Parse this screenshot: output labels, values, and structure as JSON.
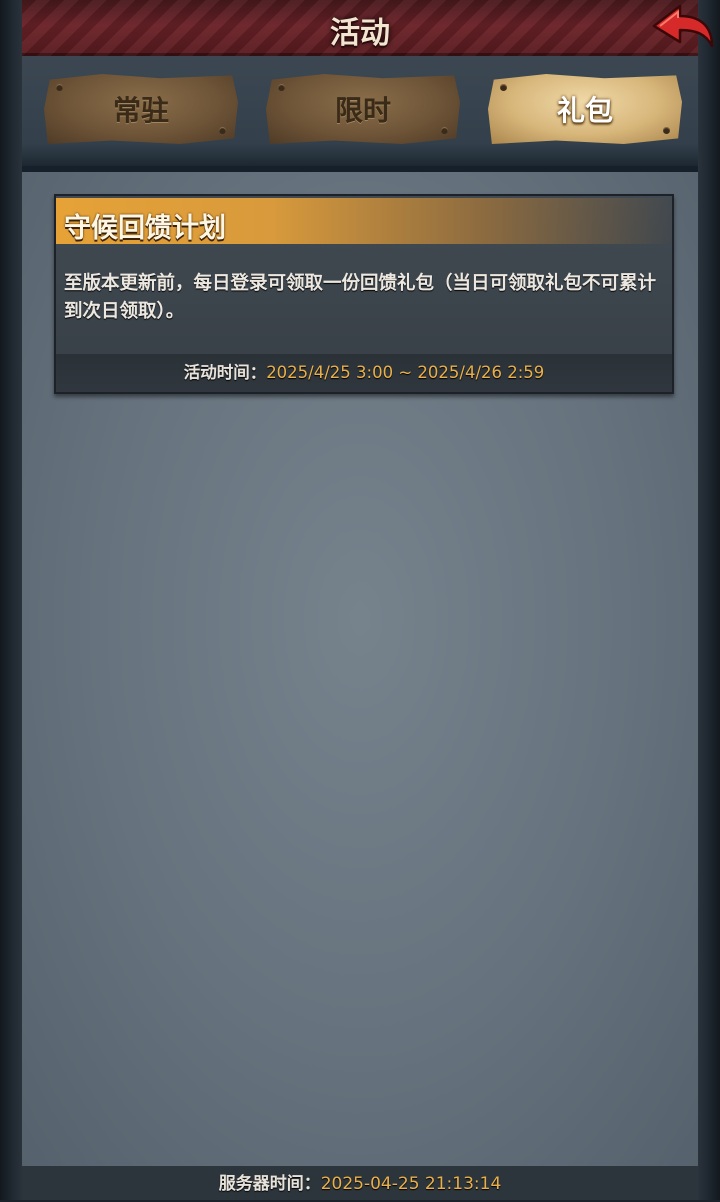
{
  "header": {
    "title": "活动",
    "back_icon": "back-arrow-icon",
    "back_icon_color": "#d62a2a"
  },
  "tabs": [
    {
      "label": "常驻",
      "active": false
    },
    {
      "label": "限时",
      "active": false
    },
    {
      "label": "礼包",
      "active": true
    }
  ],
  "activity": {
    "title": "守候回馈计划",
    "description": "至版本更新前，每日登录可领取一份回馈礼包（当日可领取礼包不可累计到次日领取）。",
    "time_label": "活动时间：",
    "time_value": "2025/4/25 3:00 ~ 2025/4/26 2:59"
  },
  "footer": {
    "server_time_label": "服务器时间：",
    "server_time_value": "2025-04-25 21:13:14"
  },
  "colors": {
    "accent_gold": "#e9b04a",
    "header_red": "#6a2228",
    "active_tab": "#d7b67a"
  }
}
